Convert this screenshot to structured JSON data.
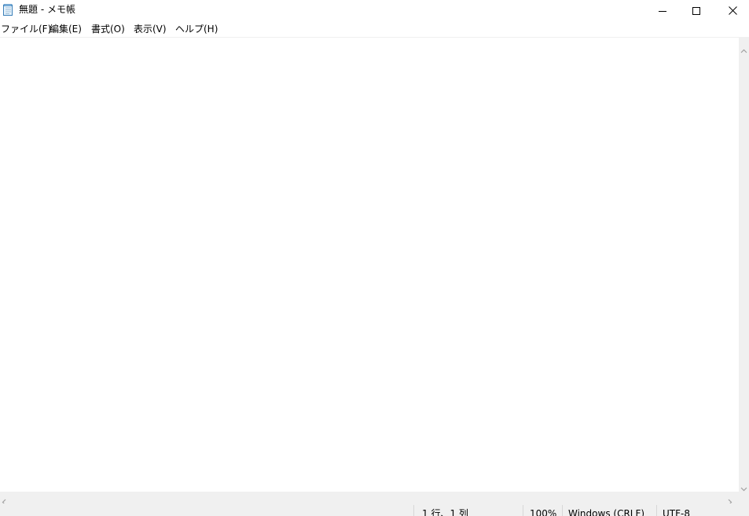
{
  "window": {
    "title": "無題 - メモ帳",
    "app_icon": "notepad-icon",
    "controls": [
      "minimize-icon",
      "maximize-icon",
      "close-icon"
    ]
  },
  "menubar": {
    "file": "ファイル(F)",
    "edit": "編集(E)",
    "format": "書式(O)",
    "view": "表示(V)",
    "help": "ヘルプ(H)"
  },
  "editor": {
    "content": ""
  },
  "statusbar": {
    "position": "1 行、1 列",
    "zoom": "100%",
    "line_ending": "Windows (CRLF)",
    "encoding": "UTF-8"
  },
  "colors": {
    "chrome_background": "#f0f0f0",
    "window_background": "#ffffff"
  }
}
